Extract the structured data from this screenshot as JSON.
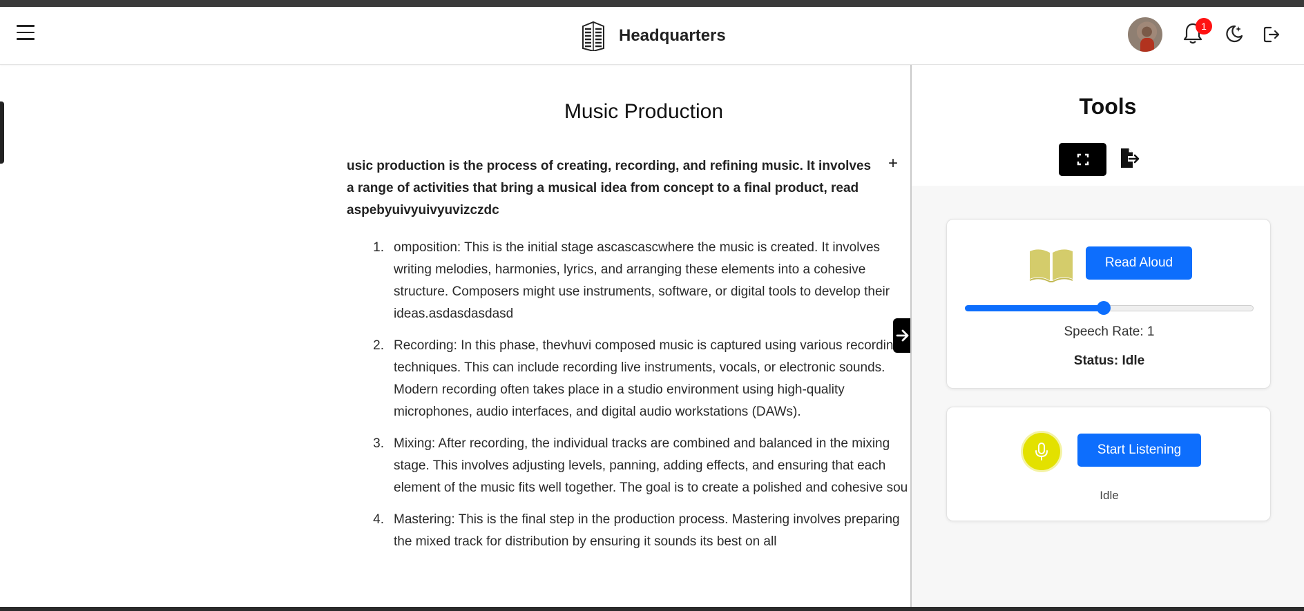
{
  "header": {
    "title": "Headquarters",
    "notification_count": "1",
    "icons": [
      "menu-icon",
      "building-icon",
      "avatar",
      "bell-icon",
      "moon-icon",
      "logout-icon"
    ]
  },
  "article": {
    "title": "Music Production",
    "lead": "usic production is the process of creating, recording, and refining music. It involves a range of activities that bring a musical idea from concept to a final product, read aspebyuivyuivyuvizczdc",
    "add_symbol": "+",
    "steps": [
      {
        "num": "1.",
        "text": "omposition: This is the initial stage ascascascwhere the music is created. It involves writing melodies, harmonies, lyrics, and arranging these elements into a cohesive structure. Composers might use instruments, software, or digital tools to develop their ideas.asdasdasdasd"
      },
      {
        "num": "2.",
        "text": "Recording: In this phase, thevhuvi composed music is captured using various recording techniques. This can include recording live instruments, vocals, or electronic sounds. Modern recording often takes place in a studio environment using high-quality microphones, audio interfaces, and digital audio workstations (DAWs)."
      },
      {
        "num": "3.",
        "text": "Mixing: After recording, the individual tracks are combined and balanced in the mixing stage. This involves adjusting levels, panning, adding effects, and ensuring that each element of the music fits well together. The goal is to create a polished and cohesive sou"
      },
      {
        "num": "4.",
        "text": "Mastering: This is the final step in the production process. Mastering involves preparing the mixed track for distribution by ensuring it sounds its best on all"
      }
    ]
  },
  "tools": {
    "title": "Tools",
    "read_aloud": {
      "button_label": "Read Aloud",
      "rate_fraction": 0.48,
      "rate_text": "Speech Rate: 1",
      "status_text": "Status: Idle"
    },
    "listening": {
      "button_label": "Start Listening",
      "status": "Idle"
    }
  },
  "colors": {
    "accent": "#0d6efd",
    "mic": "#e3e100",
    "badge": "#ff1212"
  }
}
